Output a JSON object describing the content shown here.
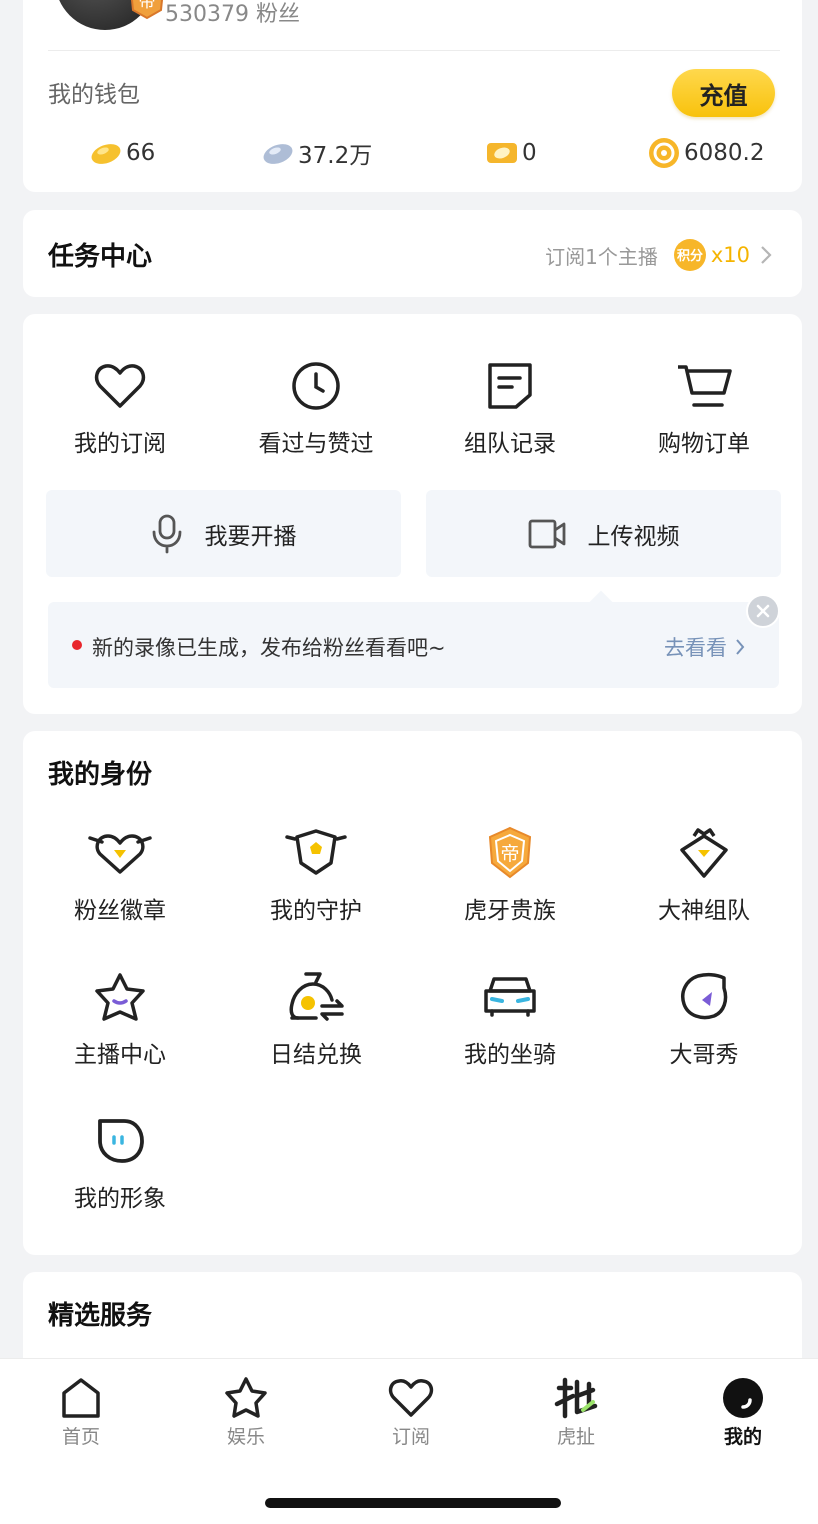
{
  "profile": {
    "fans_text": "530379 粉丝",
    "badge_char": "帝"
  },
  "wallet": {
    "title": "我的钱包",
    "recharge_label": "充值",
    "items": [
      {
        "icon": "gold-bean-icon",
        "value": "66"
      },
      {
        "icon": "silver-bean-icon",
        "value": "37.2万"
      },
      {
        "icon": "ticket-icon",
        "value": "0"
      },
      {
        "icon": "huya-coin-icon",
        "value": "6080.2"
      }
    ]
  },
  "task_center": {
    "title": "任务中心",
    "task_text": "订阅1个主播",
    "points_badge": "积分",
    "points_multiplier": "x10"
  },
  "quick_menu": {
    "items": [
      {
        "icon": "heart-icon",
        "label": "我的订阅"
      },
      {
        "icon": "clock-icon",
        "label": "看过与赞过"
      },
      {
        "icon": "note-icon",
        "label": "组队记录"
      },
      {
        "icon": "cart-icon",
        "label": "购物订单"
      }
    ],
    "start_live_label": "我要开播",
    "upload_video_label": "上传视频"
  },
  "notice": {
    "message": "新的录像已生成，发布给粉丝看看吧~",
    "action_label": "去看看"
  },
  "identity": {
    "title": "我的身份",
    "items": [
      {
        "icon": "fan-badge-icon",
        "label": "粉丝徽章"
      },
      {
        "icon": "guard-icon",
        "label": "我的守护"
      },
      {
        "icon": "noble-icon",
        "label": "虎牙贵族"
      },
      {
        "icon": "team-icon",
        "label": "大神组队"
      },
      {
        "icon": "streamer-star-icon",
        "label": "主播中心"
      },
      {
        "icon": "exchange-bag-icon",
        "label": "日结兑换"
      },
      {
        "icon": "car-icon",
        "label": "我的坐骑"
      },
      {
        "icon": "show-icon",
        "label": "大哥秀"
      },
      {
        "icon": "avatar-image-icon",
        "label": "我的形象"
      }
    ]
  },
  "services": {
    "title": "精选服务"
  },
  "tabbar": {
    "tabs": [
      {
        "icon": "home-icon",
        "label": "首页",
        "active": false
      },
      {
        "icon": "star-icon",
        "label": "娱乐",
        "active": false
      },
      {
        "icon": "heart-icon",
        "label": "订阅",
        "active": false
      },
      {
        "icon": "huche-icon",
        "label": "虎扯",
        "active": false
      },
      {
        "icon": "mine-icon",
        "label": "我的",
        "active": true
      }
    ]
  },
  "colors": {
    "accent_yellow": "#f8c20c",
    "notice_link": "#7792b8",
    "red_dot": "#e8262c"
  }
}
